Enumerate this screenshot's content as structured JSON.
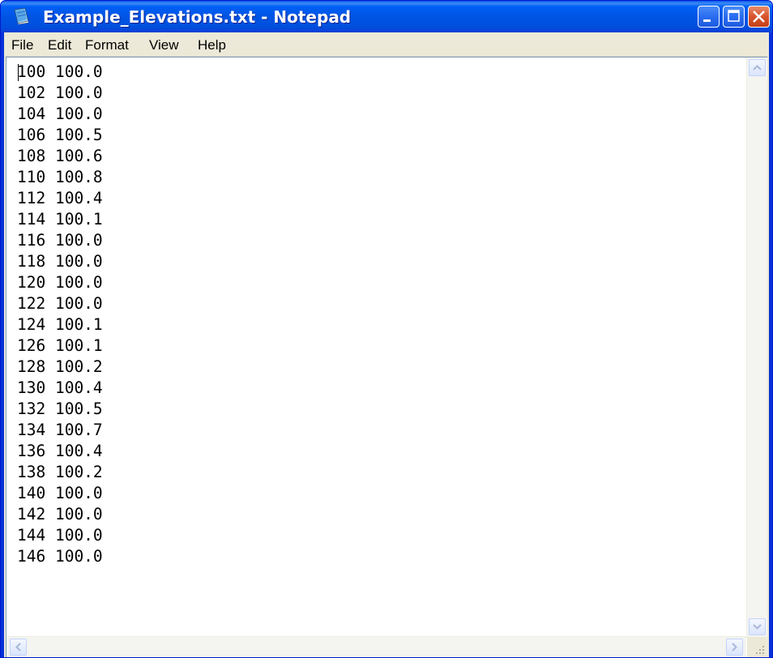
{
  "window": {
    "title": "Example_Elevations.txt - Notepad",
    "colors": {
      "titlebar": "#0054e3",
      "close_button": "#d8542c",
      "client": "#ece9d8"
    }
  },
  "menu": {
    "items": [
      {
        "label": "File"
      },
      {
        "label": "Edit"
      },
      {
        "label": "Format"
      },
      {
        "label": "View"
      },
      {
        "label": "Help"
      }
    ]
  },
  "document": {
    "content": "100 100.0\n102 100.0\n104 100.0\n106 100.5\n108 100.6\n110 100.8\n112 100.4\n114 100.1\n116 100.0\n118 100.0\n120 100.0\n122 100.0\n124 100.1\n126 100.1\n128 100.2\n130 100.4\n132 100.5\n134 100.7\n136 100.4\n138 100.2\n140 100.0\n142 100.0\n144 100.0\n146 100.0"
  },
  "icons": {
    "app": "notepad-icon",
    "minimize": "minimize-icon",
    "maximize": "maximize-icon",
    "close": "close-icon"
  }
}
